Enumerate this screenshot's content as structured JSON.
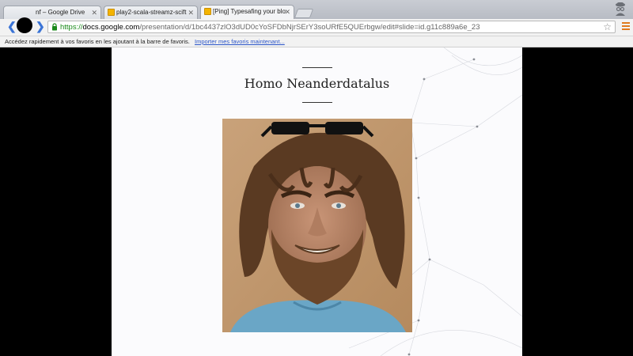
{
  "browser": {
    "tabs": [
      {
        "label": "nf – Google Drive",
        "icon": "google-drive-icon",
        "active": false
      },
      {
        "label": "play2-scala-streamz-scift",
        "icon": "google-slides-icon",
        "active": false
      },
      {
        "label": "[Ping] Typesafing your blo",
        "icon": "google-slides-icon",
        "active": true
      }
    ],
    "url": {
      "scheme": "https://",
      "host": "docs.google.com",
      "path": "/presentation/d/1bc4437zlO3dUD0cYoSFDbNjrSErY3soURfE5QUErbgw/edit#slide=id.g11c889a6e_23"
    },
    "bookmarks_bar": {
      "message": "Accédez rapidement à vos favoris en les ajoutant à la barre de favoris.",
      "import_link": "Importer mes favoris maintenant..."
    },
    "colors": {
      "accent": "#3b74d6",
      "secure": "#1a8a1a",
      "menu": "#e07a1e"
    }
  },
  "slide": {
    "title": "Homo Neanderdatalus",
    "image_icon": "caveman-photo"
  }
}
